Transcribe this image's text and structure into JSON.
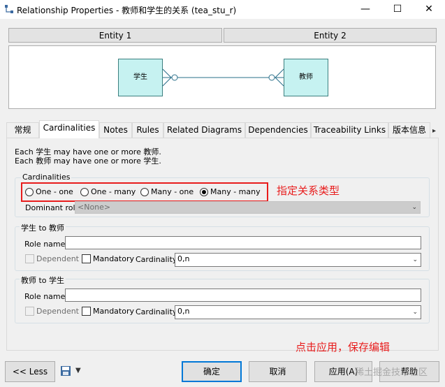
{
  "window": {
    "title": "Relationship Properties - 教师和学生的关系 (tea_stu_r)",
    "minimize": "—",
    "maximize": "☐",
    "close": "✕"
  },
  "entity_headers": [
    "Entity 1",
    "Entity 2"
  ],
  "diagram": {
    "entity1": "学生",
    "entity2": "教师"
  },
  "tabs": [
    "常规",
    "Cardinalities",
    "Notes",
    "Rules",
    "Related Diagrams",
    "Dependencies",
    "Traceability Links",
    "版本信息"
  ],
  "active_tab": "Cardinalities",
  "description": {
    "line1": "Each 学生 may have one or more 教师.",
    "line2": "Each 教师 may have one or more 学生."
  },
  "cardinalities": {
    "group_title": "Cardinalities",
    "options": [
      "One - one",
      "One - many",
      "Many - one",
      "Many - many"
    ],
    "selected": "Many - many",
    "dominant_role_label": "Dominant role:",
    "dominant_role_value": "<None>"
  },
  "annotation1": "指定关系类型",
  "role1": {
    "group_title": "学生 to 教师",
    "role_name_label": "Role name:",
    "role_name_value": "",
    "dependent_label": "Dependent",
    "mandatory_label": "Mandatory",
    "cardinality_label": "Cardinality:",
    "cardinality_value": "0,n"
  },
  "role2": {
    "group_title": "教师 to 学生",
    "role_name_label": "Role name:",
    "role_name_value": "",
    "dependent_label": "Dependent",
    "mandatory_label": "Mandatory",
    "cardinality_label": "Cardinality:",
    "cardinality_value": "0,n"
  },
  "annotation2": "点击应用，保存编辑",
  "buttons": {
    "less": "<< Less",
    "ok": "确定",
    "cancel": "取消",
    "apply": "应用(A)",
    "help": "帮助"
  },
  "watermark": "稀土掘金技术社区"
}
